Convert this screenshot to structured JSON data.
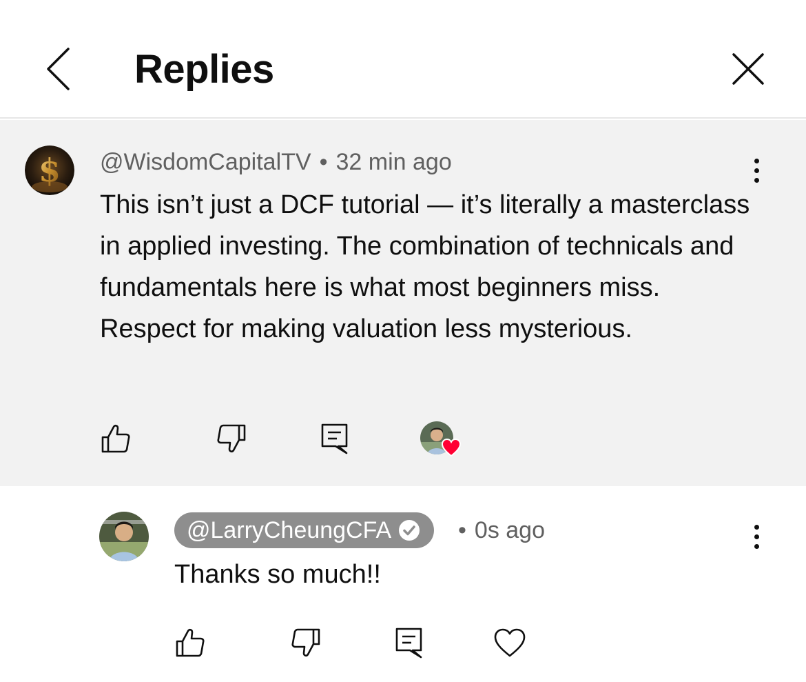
{
  "header": {
    "title": "Replies",
    "back_icon": "chevron-left-icon",
    "close_icon": "close-icon"
  },
  "parent_comment": {
    "author": "@WisdomCapitalTV",
    "separator": "•",
    "time": "32 min ago",
    "text": "This isn’t just a DCF tutorial — it’s literally a masterclass in applied investing. The combination of technicals and fundamentals here is what most beginners miss. Respect for making valuation less mysterious.",
    "avatar_icon": "dollar-sign-avatar",
    "creator_heart": true,
    "heart_color": "#ff0033"
  },
  "reply": {
    "author": "@LarryCheungCFA",
    "verified": true,
    "separator": "•",
    "time": "0s ago",
    "text": "Thanks so much!!",
    "chip_color": "#8e8e8e"
  },
  "colors": {
    "parent_background": "#f2f2f2",
    "meta_text": "#606060",
    "heart": "#ff0033"
  }
}
